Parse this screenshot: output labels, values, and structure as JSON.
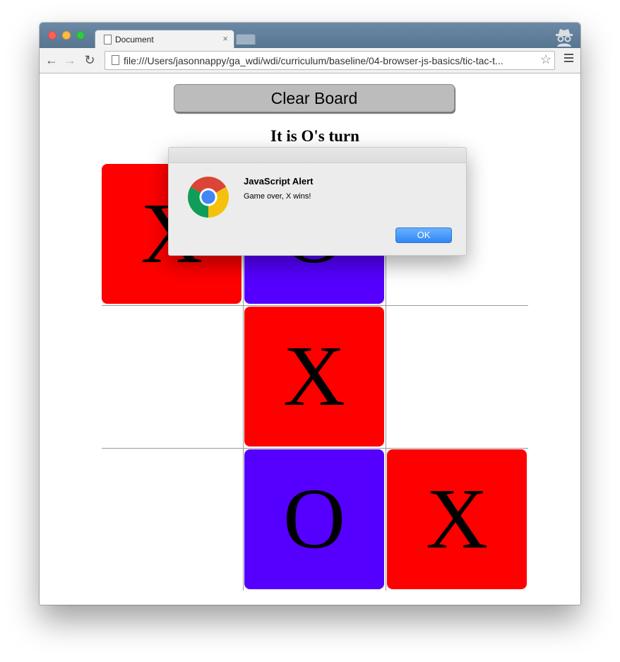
{
  "browser": {
    "tab_title": "Document",
    "tab_close": "×",
    "url": "file:///Users/jasonnappy/ga_wdi/wdi/curriculum/baseline/04-browser-js-basics/tic-tac-t...",
    "nav_back": "←",
    "nav_forward": "→",
    "nav_reload": "↻",
    "bookmark_star": "☆"
  },
  "page": {
    "clear_button_label": "Clear Board",
    "turn_text": "It is O's turn"
  },
  "board": {
    "cells": [
      {
        "mark": "X",
        "color": "#ff0000"
      },
      {
        "mark": "O",
        "color": "#5500ff"
      },
      {
        "mark": "",
        "color": "#ffffff"
      },
      {
        "mark": "",
        "color": "#ffffff"
      },
      {
        "mark": "X",
        "color": "#ff0000"
      },
      {
        "mark": "",
        "color": "#ffffff"
      },
      {
        "mark": "",
        "color": "#ffffff"
      },
      {
        "mark": "O",
        "color": "#5500ff"
      },
      {
        "mark": "X",
        "color": "#ff0000"
      }
    ]
  },
  "alert": {
    "title": "JavaScript Alert",
    "message": "Game over, X wins!",
    "ok_label": "OK"
  }
}
